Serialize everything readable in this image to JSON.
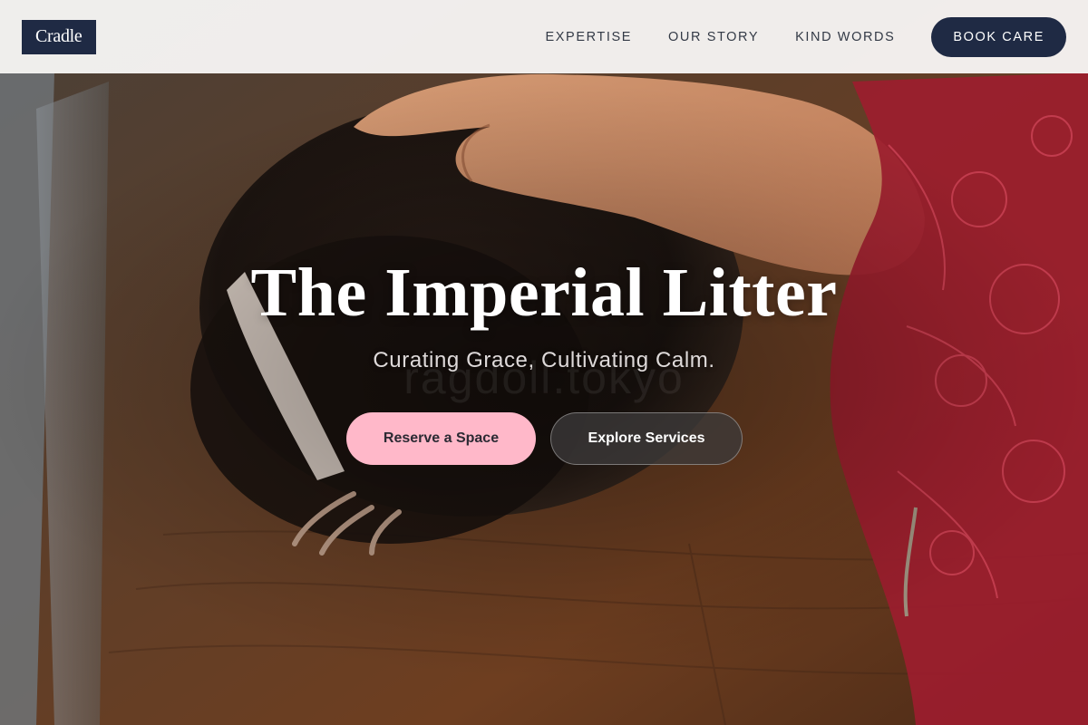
{
  "brand": {
    "logo_text": "Cradle"
  },
  "nav": {
    "links": [
      {
        "label": "EXPERTISE"
      },
      {
        "label": "OUR STORY"
      },
      {
        "label": "KIND WORDS"
      }
    ],
    "cta_label": "BOOK CARE"
  },
  "hero": {
    "title": "The Imperial Litter",
    "subtitle": "Curating Grace, Cultivating Calm.",
    "watermark": "ragdoll.tokyo",
    "primary_cta": "Reserve a Space",
    "secondary_cta": "Explore Services",
    "background_image": "photo of a small dark furry animal with a white stripe being petted by a hand on a wooden table beside red lace"
  },
  "colors": {
    "navy": "#1f2a44",
    "pink": "#ffb8c9",
    "nav_bg": "#faf9f8",
    "nav_text": "#333a46"
  }
}
